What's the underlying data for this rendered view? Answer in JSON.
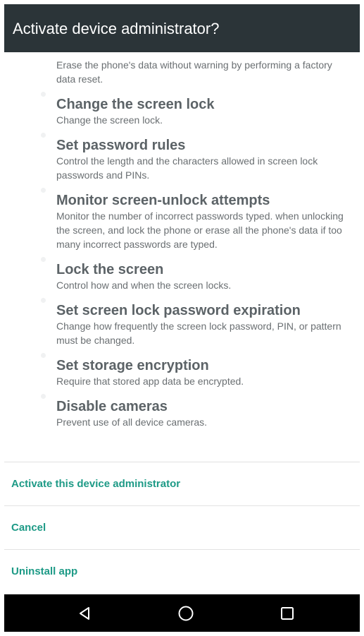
{
  "dialog": {
    "title": "Activate device administrator?"
  },
  "permissions": [
    {
      "title": "",
      "description": "Erase the phone's data without warning by performing a factory data reset."
    },
    {
      "title": "Change the screen lock",
      "description": "Change the screen lock."
    },
    {
      "title": "Set password rules",
      "description": "Control the length and the characters allowed in screen lock passwords and PINs."
    },
    {
      "title": "Monitor screen-unlock attempts",
      "description": "Monitor the number of incorrect passwords typed. when unlocking the screen, and lock the phone or erase all the phone's data if too many incorrect passwords are typed."
    },
    {
      "title": "Lock the screen",
      "description": "Control how and when the screen locks."
    },
    {
      "title": "Set screen lock password expiration",
      "description": "Change how frequently the screen lock password, PIN, or pattern must be changed."
    },
    {
      "title": "Set storage encryption",
      "description": "Require that stored app data be encrypted."
    },
    {
      "title": "Disable cameras",
      "description": "Prevent use of all device cameras."
    }
  ],
  "actions": {
    "activate_label": "Activate this device administrator",
    "cancel_label": "Cancel",
    "uninstall_label": "Uninstall app"
  },
  "nav_bar": {
    "back_icon": "back-triangle-icon",
    "home_icon": "home-circle-icon",
    "recents_icon": "recents-square-icon"
  },
  "colors": {
    "title_bar": "#2b3438",
    "accent": "#1d9a86",
    "nav_bar": "#000000"
  }
}
